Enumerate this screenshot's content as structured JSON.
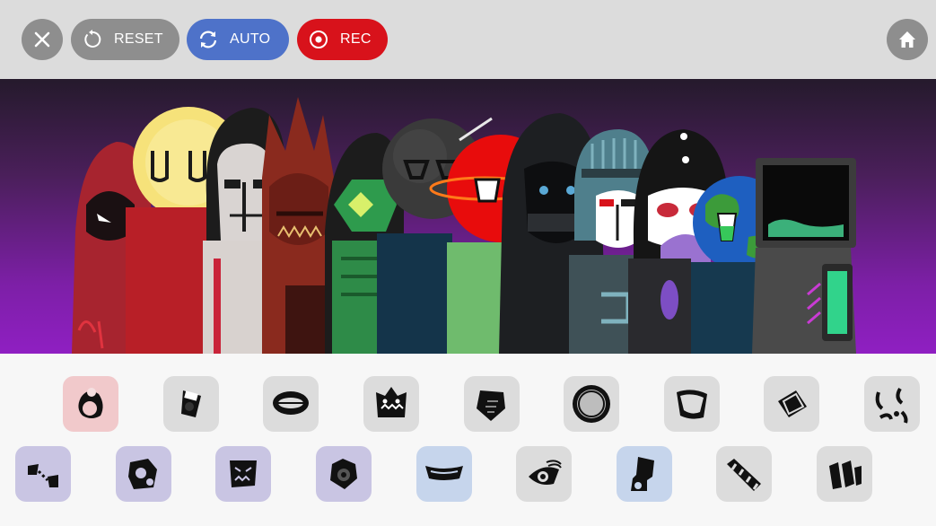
{
  "toolbar": {
    "close_icon": "close-icon",
    "reset_label": "RESET",
    "auto_label": "AUTO",
    "rec_label": "REC",
    "home_icon": "home-icon",
    "colors": {
      "gray": "#8e8e8e",
      "auto": "#4e72c9",
      "rec": "#d8121b"
    }
  },
  "stage": {
    "characters": [
      "red-hood-ninja",
      "moon-face",
      "pale-man",
      "horned-demon",
      "green-robot",
      "dark-orb",
      "red-planet",
      "hooded-figure",
      "teal-cyborg",
      "bun-hair-girl",
      "earth-globe",
      "monitor-robot"
    ]
  },
  "palette": {
    "row1": [
      {
        "icon": "pink-creature-sound-icon",
        "bg": "#f1c9cb"
      },
      {
        "icon": "cup-sound-icon",
        "bg": "#dcdcdc"
      },
      {
        "icon": "mouth-sound-icon",
        "bg": "#dcdcdc"
      },
      {
        "icon": "monster-face-sound-icon",
        "bg": "#dcdcdc"
      },
      {
        "icon": "shard-sound-icon",
        "bg": "#dcdcdc"
      },
      {
        "icon": "sun-gear-sound-icon",
        "bg": "#dcdcdc"
      },
      {
        "icon": "mask-sound-icon",
        "bg": "#dcdcdc"
      },
      {
        "icon": "diamond-sound-icon",
        "bg": "#dcdcdc"
      },
      {
        "icon": "swirl-sound-icon",
        "bg": "#dcdcdc"
      }
    ],
    "row2": [
      {
        "icon": "tape-sound-icon",
        "bg": "#c9c5e3"
      },
      {
        "icon": "gears-sound-icon",
        "bg": "#c9c5e3"
      },
      {
        "icon": "claw-face-sound-icon",
        "bg": "#c9c5e3"
      },
      {
        "icon": "rose-sound-icon",
        "bg": "#c9c5e3"
      },
      {
        "icon": "visor-sound-icon",
        "bg": "#c6d5ec"
      },
      {
        "icon": "eye-sound-icon",
        "bg": "#dcdcdc"
      },
      {
        "icon": "plug-sound-icon",
        "bg": "#c6d5ec"
      },
      {
        "icon": "stripes-sound-icon",
        "bg": "#dcdcdc"
      },
      {
        "icon": "panels-sound-icon",
        "bg": "#dcdcdc"
      }
    ]
  }
}
